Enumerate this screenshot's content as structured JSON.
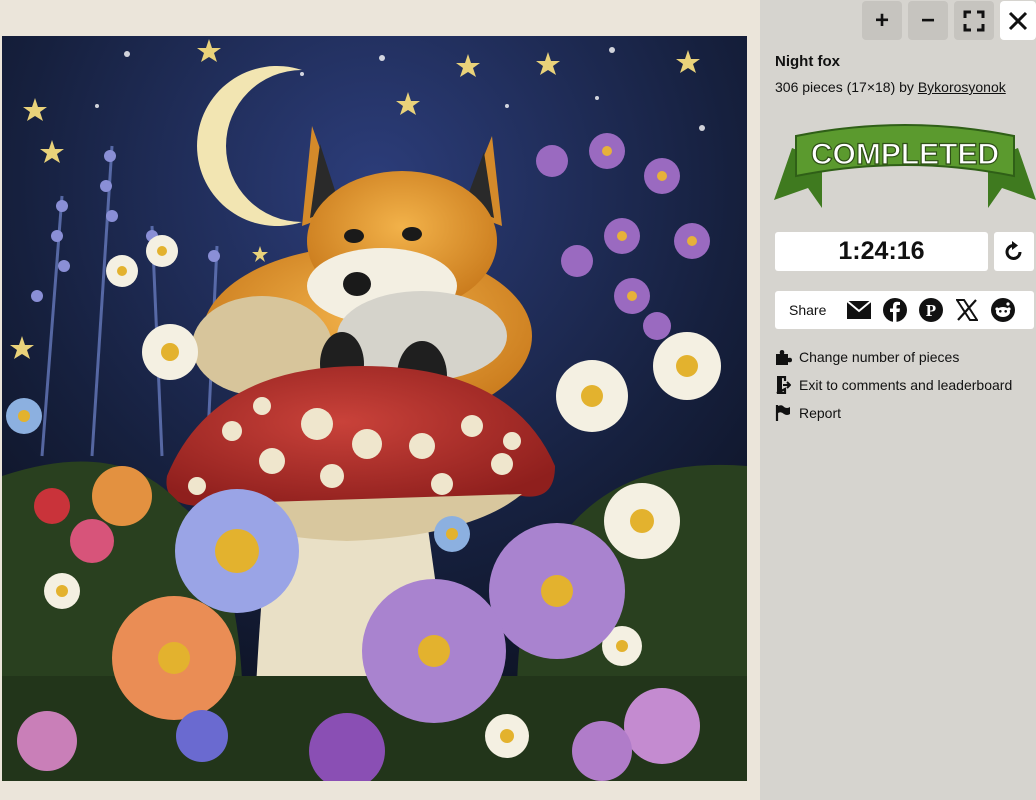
{
  "toolbar": {
    "zoom_in": "+",
    "zoom_out": "−",
    "fullscreen_icon": "fullscreen-icon",
    "close_icon": "close-icon"
  },
  "puzzle": {
    "title": "Night fox",
    "meta_prefix": "306 pieces (17×18) by ",
    "author": "Bykorosyonok",
    "image_description_icon": "fox-on-mushroom-artwork"
  },
  "status": {
    "ribbon_text": "COMPLETED",
    "ribbon_color": "#5b9a2e"
  },
  "timer": {
    "value": "1:24:16",
    "restart_icon": "restart-icon"
  },
  "share": {
    "label": "Share",
    "icons": [
      "mail-icon",
      "facebook-icon",
      "pinterest-icon",
      "x-icon",
      "reddit-icon"
    ]
  },
  "menu": {
    "change_pieces": "Change number of pieces",
    "exit_comments": "Exit to comments and leaderboard",
    "report": "Report"
  },
  "colors": {
    "sidebar_bg": "#d6d4cf",
    "page_bg": "#ebe5da",
    "night_sky": "#16203e"
  }
}
